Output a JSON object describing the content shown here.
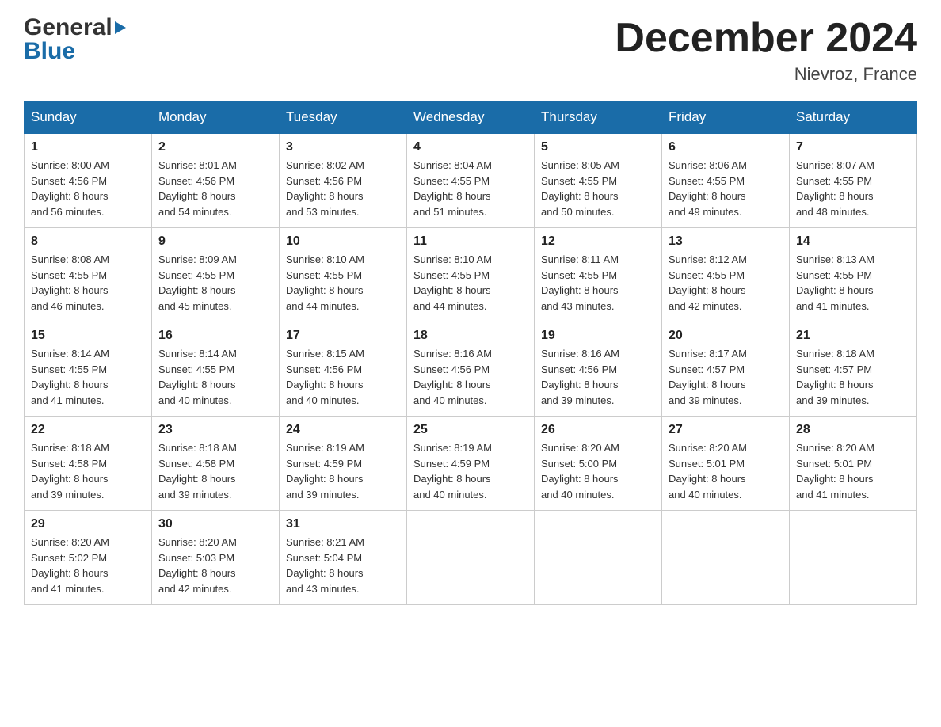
{
  "header": {
    "logo_general": "General",
    "logo_blue": "Blue",
    "month_title": "December 2024",
    "location": "Nievroz, France"
  },
  "weekdays": [
    "Sunday",
    "Monday",
    "Tuesday",
    "Wednesday",
    "Thursday",
    "Friday",
    "Saturday"
  ],
  "weeks": [
    [
      {
        "day": "1",
        "sunrise": "8:00 AM",
        "sunset": "4:56 PM",
        "daylight": "8 hours and 56 minutes."
      },
      {
        "day": "2",
        "sunrise": "8:01 AM",
        "sunset": "4:56 PM",
        "daylight": "8 hours and 54 minutes."
      },
      {
        "day": "3",
        "sunrise": "8:02 AM",
        "sunset": "4:56 PM",
        "daylight": "8 hours and 53 minutes."
      },
      {
        "day": "4",
        "sunrise": "8:04 AM",
        "sunset": "4:55 PM",
        "daylight": "8 hours and 51 minutes."
      },
      {
        "day": "5",
        "sunrise": "8:05 AM",
        "sunset": "4:55 PM",
        "daylight": "8 hours and 50 minutes."
      },
      {
        "day": "6",
        "sunrise": "8:06 AM",
        "sunset": "4:55 PM",
        "daylight": "8 hours and 49 minutes."
      },
      {
        "day": "7",
        "sunrise": "8:07 AM",
        "sunset": "4:55 PM",
        "daylight": "8 hours and 48 minutes."
      }
    ],
    [
      {
        "day": "8",
        "sunrise": "8:08 AM",
        "sunset": "4:55 PM",
        "daylight": "8 hours and 46 minutes."
      },
      {
        "day": "9",
        "sunrise": "8:09 AM",
        "sunset": "4:55 PM",
        "daylight": "8 hours and 45 minutes."
      },
      {
        "day": "10",
        "sunrise": "8:10 AM",
        "sunset": "4:55 PM",
        "daylight": "8 hours and 44 minutes."
      },
      {
        "day": "11",
        "sunrise": "8:10 AM",
        "sunset": "4:55 PM",
        "daylight": "8 hours and 44 minutes."
      },
      {
        "day": "12",
        "sunrise": "8:11 AM",
        "sunset": "4:55 PM",
        "daylight": "8 hours and 43 minutes."
      },
      {
        "day": "13",
        "sunrise": "8:12 AM",
        "sunset": "4:55 PM",
        "daylight": "8 hours and 42 minutes."
      },
      {
        "day": "14",
        "sunrise": "8:13 AM",
        "sunset": "4:55 PM",
        "daylight": "8 hours and 41 minutes."
      }
    ],
    [
      {
        "day": "15",
        "sunrise": "8:14 AM",
        "sunset": "4:55 PM",
        "daylight": "8 hours and 41 minutes."
      },
      {
        "day": "16",
        "sunrise": "8:14 AM",
        "sunset": "4:55 PM",
        "daylight": "8 hours and 40 minutes."
      },
      {
        "day": "17",
        "sunrise": "8:15 AM",
        "sunset": "4:56 PM",
        "daylight": "8 hours and 40 minutes."
      },
      {
        "day": "18",
        "sunrise": "8:16 AM",
        "sunset": "4:56 PM",
        "daylight": "8 hours and 40 minutes."
      },
      {
        "day": "19",
        "sunrise": "8:16 AM",
        "sunset": "4:56 PM",
        "daylight": "8 hours and 39 minutes."
      },
      {
        "day": "20",
        "sunrise": "8:17 AM",
        "sunset": "4:57 PM",
        "daylight": "8 hours and 39 minutes."
      },
      {
        "day": "21",
        "sunrise": "8:18 AM",
        "sunset": "4:57 PM",
        "daylight": "8 hours and 39 minutes."
      }
    ],
    [
      {
        "day": "22",
        "sunrise": "8:18 AM",
        "sunset": "4:58 PM",
        "daylight": "8 hours and 39 minutes."
      },
      {
        "day": "23",
        "sunrise": "8:18 AM",
        "sunset": "4:58 PM",
        "daylight": "8 hours and 39 minutes."
      },
      {
        "day": "24",
        "sunrise": "8:19 AM",
        "sunset": "4:59 PM",
        "daylight": "8 hours and 39 minutes."
      },
      {
        "day": "25",
        "sunrise": "8:19 AM",
        "sunset": "4:59 PM",
        "daylight": "8 hours and 40 minutes."
      },
      {
        "day": "26",
        "sunrise": "8:20 AM",
        "sunset": "5:00 PM",
        "daylight": "8 hours and 40 minutes."
      },
      {
        "day": "27",
        "sunrise": "8:20 AM",
        "sunset": "5:01 PM",
        "daylight": "8 hours and 40 minutes."
      },
      {
        "day": "28",
        "sunrise": "8:20 AM",
        "sunset": "5:01 PM",
        "daylight": "8 hours and 41 minutes."
      }
    ],
    [
      {
        "day": "29",
        "sunrise": "8:20 AM",
        "sunset": "5:02 PM",
        "daylight": "8 hours and 41 minutes."
      },
      {
        "day": "30",
        "sunrise": "8:20 AM",
        "sunset": "5:03 PM",
        "daylight": "8 hours and 42 minutes."
      },
      {
        "day": "31",
        "sunrise": "8:21 AM",
        "sunset": "5:04 PM",
        "daylight": "8 hours and 43 minutes."
      },
      null,
      null,
      null,
      null
    ]
  ],
  "labels": {
    "sunrise": "Sunrise: ",
    "sunset": "Sunset: ",
    "daylight": "Daylight: "
  }
}
